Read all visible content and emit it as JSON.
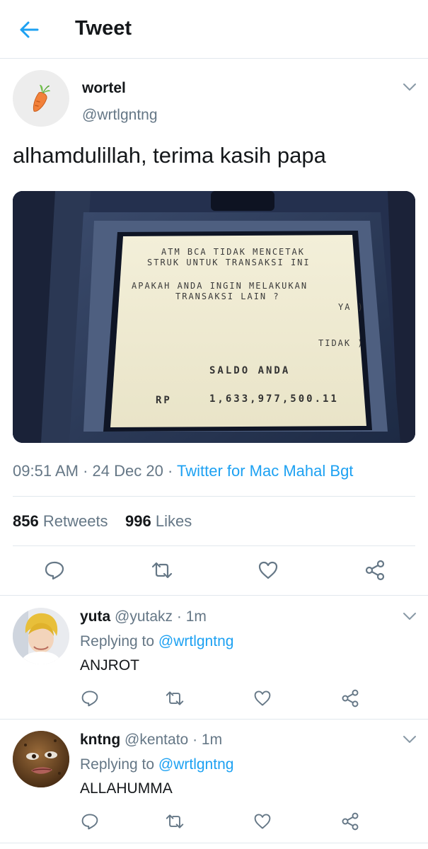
{
  "header": {
    "title": "Tweet"
  },
  "tweet": {
    "author_name": "wortel",
    "author_handle": "@wrtlgntng",
    "text": "alhamdulillah, terima kasih papa",
    "atm_screen": {
      "line1": "ATM BCA TIDAK MENCETAK",
      "line2": "STRUK UNTUK TRANSAKSI INI",
      "line3": "APAKAH ANDA INGIN MELAKUKAN",
      "line4": "TRANSAKSI LAIN ?",
      "ya": "YA )",
      "tidak": "TIDAK )",
      "saldo": "SALDO ANDA",
      "rp": "RP",
      "amount": "1,633,977,500.11"
    },
    "time": "09:51 AM",
    "date": "24 Dec 20",
    "source": "Twitter for Mac Mahal Bgt",
    "retweets_count": "856",
    "retweets_label": "Retweets",
    "likes_count": "996",
    "likes_label": "Likes"
  },
  "replies": [
    {
      "name": "yuta",
      "handle": "@yutakz",
      "time": "1m",
      "replying_label": "Replying to",
      "replying_to": "@wrtlgntng",
      "text": "ANJROT"
    },
    {
      "name": "kntng",
      "handle": "@kentato",
      "time": "1m",
      "replying_label": "Replying to",
      "replying_to": "@wrtlgntng",
      "text": "ALLAHUMMA"
    }
  ],
  "colors": {
    "accent": "#1da1f2",
    "secondary_text": "#657786",
    "icon": "#657786",
    "divider": "#e1e8ed"
  }
}
